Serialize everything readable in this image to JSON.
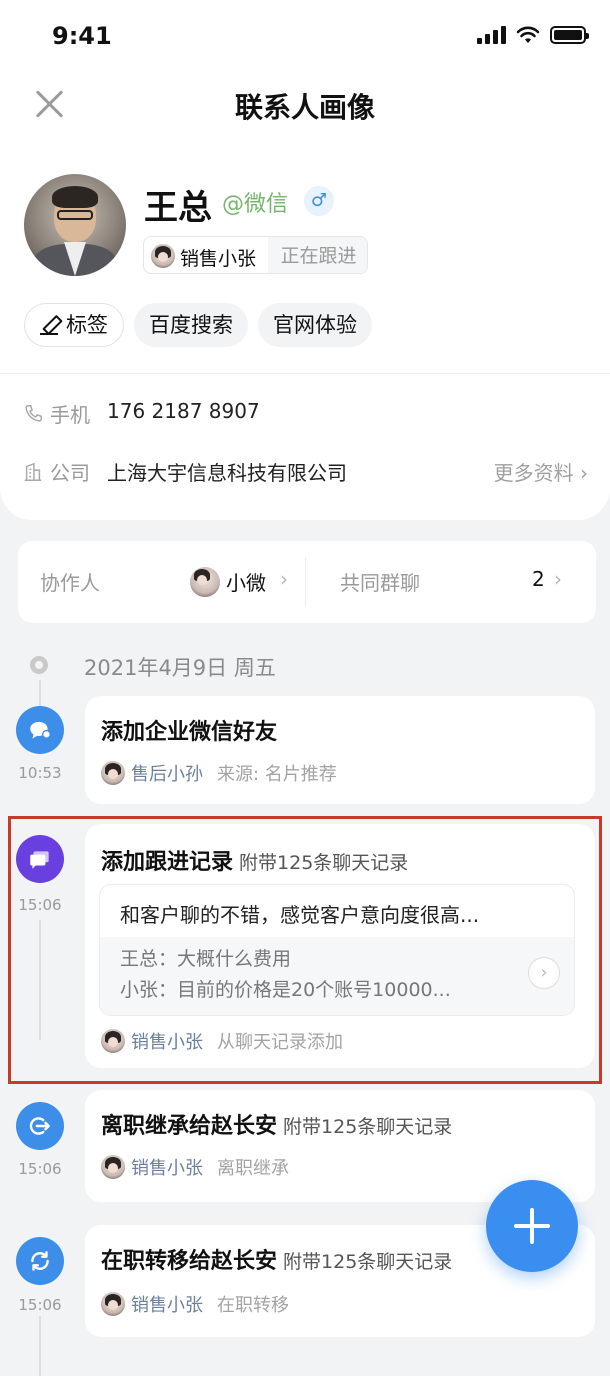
{
  "status_bar": {
    "time": "9:41"
  },
  "nav": {
    "title": "联系人画像"
  },
  "profile": {
    "name": "王总",
    "source": "@微信",
    "gender_symbol": "♂",
    "owner_name": "销售小张",
    "owner_status": "正在跟进"
  },
  "tags": {
    "edit_label": "标签",
    "items": [
      "百度搜索",
      "官网体验"
    ]
  },
  "contact_info": {
    "phone_label": "手机",
    "phone_value": "176 2187 8907",
    "company_label": "公司",
    "company_value": "上海大宇信息科技有限公司",
    "more_label": "更多资料 ›"
  },
  "collaboration": {
    "collaborator_label": "协作人",
    "collaborator_name": "小微",
    "group_label": "共同群聊",
    "group_count": "2"
  },
  "timeline": {
    "date": "2021年4月9日 周五",
    "events": [
      {
        "time": "10:53",
        "title": "添加企业微信好友",
        "sub": "",
        "actor": "售后小孙",
        "source": "来源: 名片推荐",
        "color": "#3d8ee9",
        "icon": "chat-bubble-icon"
      },
      {
        "time": "15:06",
        "title": "添加跟进记录",
        "sub": "附带125条聊天记录",
        "actor": "销售小张",
        "source": "从聊天记录添加",
        "color": "#6a3fe0",
        "icon": "message-icon",
        "note": "和客户聊的不错，感觉客户意向度很高...",
        "chat_lines": [
          "王总：大概什么费用",
          "小张：目前的价格是20个账号10000..."
        ]
      },
      {
        "time": "15:06",
        "title": "离职继承给赵长安",
        "sub": "附带125条聊天记录",
        "actor": "销售小张",
        "source": "离职继承",
        "color": "#3d8ee9",
        "icon": "exit-icon"
      },
      {
        "time": "15:06",
        "title": "在职转移给赵长安",
        "sub": "附带125条聊天记录",
        "actor": "销售小张",
        "source": "在职转移",
        "color": "#3d8ee9",
        "icon": "transfer-icon"
      }
    ]
  },
  "colors": {
    "accent": "#3a8ef0",
    "purple": "#6a3fe0",
    "highlight": "#c8392b"
  }
}
